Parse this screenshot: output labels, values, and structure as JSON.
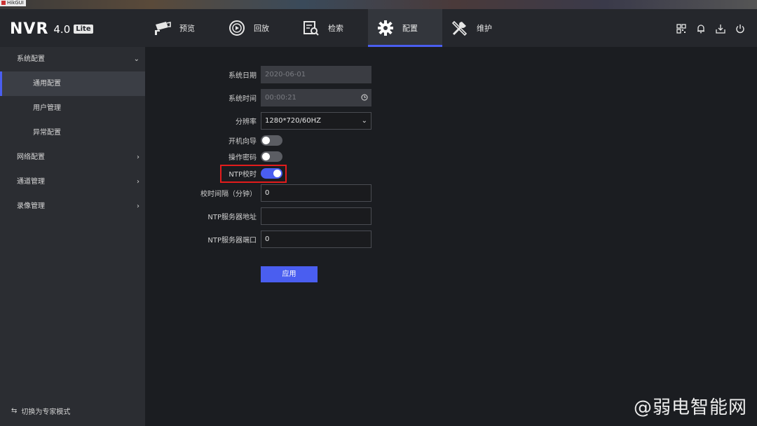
{
  "window": {
    "title": "HikGUI"
  },
  "app": {
    "logo_main": "NVR",
    "logo_version": "4.0",
    "logo_badge": "Lite"
  },
  "nav": {
    "items": [
      {
        "label": "预览",
        "icon": "camera-icon"
      },
      {
        "label": "回放",
        "icon": "playback-icon"
      },
      {
        "label": "检索",
        "icon": "search-icon"
      },
      {
        "label": "配置",
        "icon": "gear-icon",
        "active": true
      },
      {
        "label": "维护",
        "icon": "tools-icon"
      }
    ]
  },
  "header_tools": [
    "qr-code-icon",
    "bell-icon",
    "download-icon",
    "power-icon"
  ],
  "sidebar": {
    "groups": [
      {
        "label": "系统配置",
        "expanded": true
      },
      {
        "label": "通用配置",
        "active": true
      },
      {
        "label": "用户管理"
      },
      {
        "label": "异常配置"
      },
      {
        "label": "网络配置"
      },
      {
        "label": "通道管理"
      },
      {
        "label": "录像管理"
      }
    ],
    "expert_mode": "切换为专家模式"
  },
  "form": {
    "date_label": "系统日期",
    "date_value": "2020-06-01",
    "time_label": "系统时间",
    "time_value": "00:00:21",
    "resolution_label": "分辨率",
    "resolution_value": "1280*720/60HZ",
    "wizard_label": "开机向导",
    "wizard_on": false,
    "password_label": "操作密码",
    "password_on": false,
    "ntp_label": "NTP校时",
    "ntp_on": true,
    "interval_label": "校时间隔（分钟）",
    "interval_value": "0",
    "server_label": "NTP服务器地址",
    "server_value": "",
    "port_label": "NTP服务器端口",
    "port_value": "0",
    "apply_label": "应用"
  },
  "watermark": "@弱电智能网",
  "colors": {
    "accent": "#4a5ef0",
    "highlight": "#e31c1c"
  }
}
